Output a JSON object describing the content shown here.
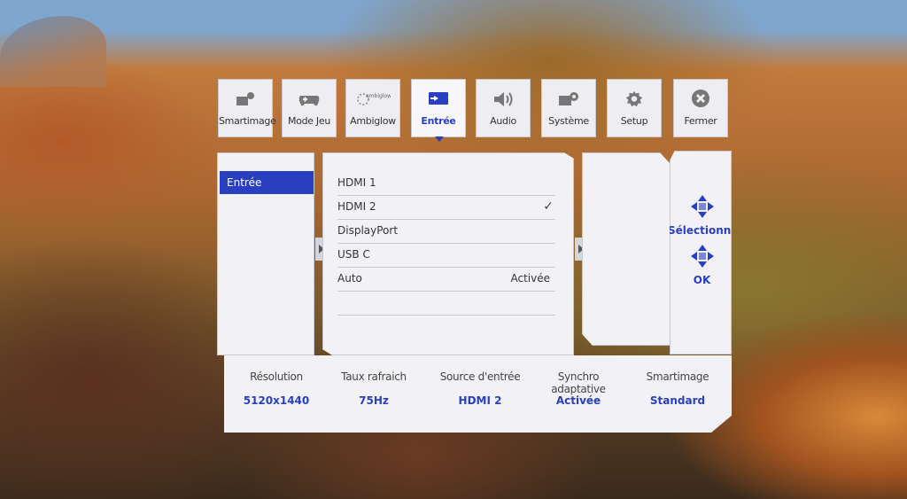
{
  "tabs": [
    {
      "label": "Smartimage",
      "icon": "smartimage-icon"
    },
    {
      "label": "Mode Jeu",
      "icon": "gamepad-icon"
    },
    {
      "label": "Ambiglow",
      "icon": "ambiglow-icon",
      "icon_text": "ambiglow"
    },
    {
      "label": "Entrée",
      "icon": "input-icon"
    },
    {
      "label": "Audio",
      "icon": "speaker-icon"
    },
    {
      "label": "Système",
      "icon": "system-icon"
    },
    {
      "label": "Setup",
      "icon": "gear-icon"
    },
    {
      "label": "Fermer",
      "icon": "close-icon"
    }
  ],
  "active_tab": "Entrée",
  "submenu": {
    "selected": "Entrée"
  },
  "options": [
    {
      "label": "HDMI 1",
      "value": ""
    },
    {
      "label": "HDMI 2",
      "value": "",
      "checked": true
    },
    {
      "label": "DisplayPort",
      "value": ""
    },
    {
      "label": "USB C",
      "value": ""
    },
    {
      "label": "Auto",
      "value": "Activée"
    }
  ],
  "nav": {
    "select": "Sélectionner",
    "ok": "OK"
  },
  "status": [
    {
      "key": "Résolution",
      "value": "5120x1440"
    },
    {
      "key": "Taux rafraich",
      "value": "75Hz"
    },
    {
      "key": "Source d'entrée",
      "value": "HDMI 2"
    },
    {
      "key": "Synchro adaptative",
      "value": "Activée"
    },
    {
      "key": "Smartimage",
      "value": "Standard"
    }
  ],
  "colors": {
    "accent": "#2a3fbf",
    "panel": "#f2f2f6"
  }
}
